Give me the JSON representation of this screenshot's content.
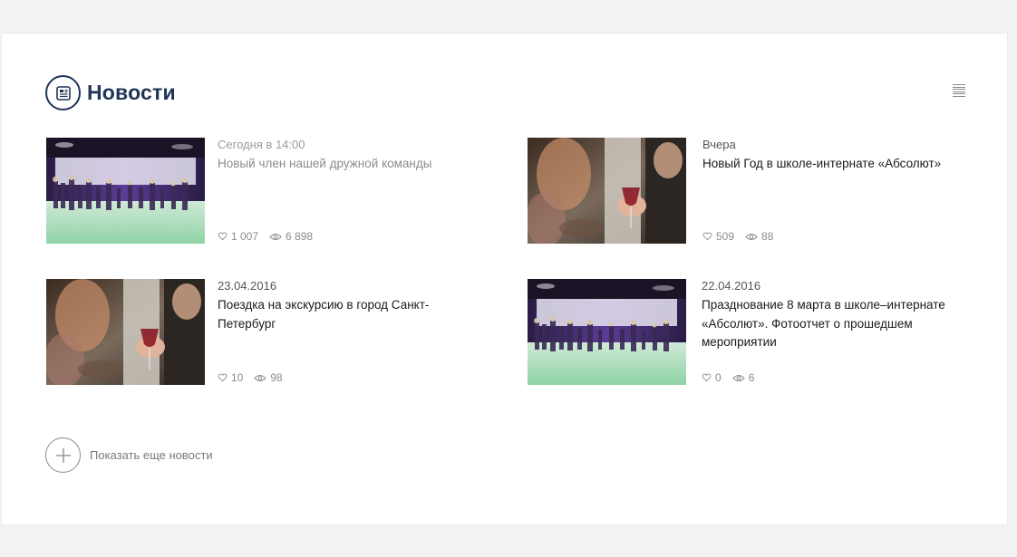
{
  "section": {
    "title": "Новости",
    "icon": "newspaper-icon"
  },
  "news": [
    {
      "date": "Сегодня в 14:00",
      "title": "Новый член нашей дружной команды",
      "likes": "1 007",
      "views": "6 898",
      "image": "party-hall-photo",
      "muted": true
    },
    {
      "date": "Вчера",
      "title": "Новый Год в школе-интернате «Абсолют»",
      "likes": "509",
      "views": "88",
      "image": "wine-glass-photo",
      "muted": false
    },
    {
      "date": "23.04.2016",
      "title": "Поездка на экскурсию в город Санкт-Петербург",
      "likes": "10",
      "views": "98",
      "image": "wine-glass-photo",
      "muted": false
    },
    {
      "date": "22.04.2016",
      "title": "Празднование 8 марта в школе–интернате «Абсолют». Фотоотчет о прошедшем мероприятии",
      "likes": "0",
      "views": "6",
      "image": "party-hall-photo",
      "muted": false
    }
  ],
  "show_more": {
    "label": "Показать еще новости",
    "icon": "plus-icon"
  },
  "colors": {
    "accent": "#1e3556",
    "background": "#f2f2f2",
    "card": "#ffffff"
  }
}
